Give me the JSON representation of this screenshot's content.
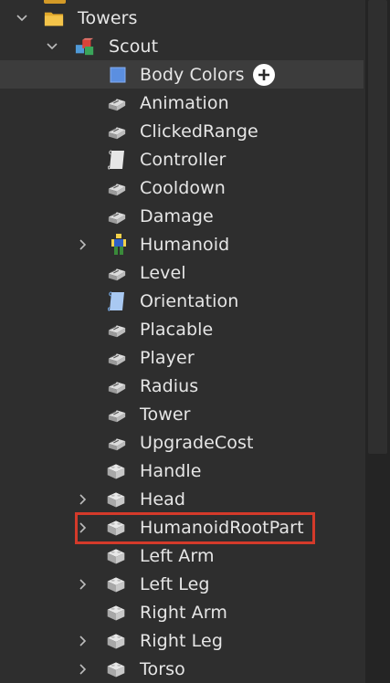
{
  "tree": {
    "towers": {
      "label": "Towers",
      "icon": "folder-icon"
    },
    "scout": {
      "label": "Scout",
      "icon": "model-icon"
    },
    "items": [
      {
        "label": "Body Colors",
        "icon": "body-colors-icon",
        "selected": true
      },
      {
        "label": "Animation",
        "icon": "value-icon"
      },
      {
        "label": "ClickedRange",
        "icon": "value-icon"
      },
      {
        "label": "Controller",
        "icon": "script-icon"
      },
      {
        "label": "Cooldown",
        "icon": "value-icon"
      },
      {
        "label": "Damage",
        "icon": "value-icon"
      },
      {
        "label": "Humanoid",
        "icon": "humanoid-icon",
        "expandable": true
      },
      {
        "label": "Level",
        "icon": "value-icon"
      },
      {
        "label": "Orientation",
        "icon": "local-script-icon"
      },
      {
        "label": "Placable",
        "icon": "value-icon"
      },
      {
        "label": "Player",
        "icon": "value-icon"
      },
      {
        "label": "Radius",
        "icon": "value-icon"
      },
      {
        "label": "Tower",
        "icon": "value-icon"
      },
      {
        "label": "UpgradeCost",
        "icon": "value-icon"
      },
      {
        "label": "Handle",
        "icon": "part-icon"
      },
      {
        "label": "Head",
        "icon": "part-icon",
        "expandable": true
      },
      {
        "label": "HumanoidRootPart",
        "icon": "part-icon",
        "expandable": true,
        "highlighted": true
      },
      {
        "label": "Left Arm",
        "icon": "part-icon"
      },
      {
        "label": "Left Leg",
        "icon": "part-icon",
        "expandable": true
      },
      {
        "label": "Right Arm",
        "icon": "part-icon"
      },
      {
        "label": "Right Leg",
        "icon": "part-icon",
        "expandable": true
      },
      {
        "label": "Torso",
        "icon": "part-icon",
        "expandable": true
      }
    ]
  },
  "colors": {
    "background": "#2e2e2e",
    "selected_row": "#3c3c3c",
    "highlight_box": "#d43a2a",
    "text": "#e6e6e6"
  }
}
